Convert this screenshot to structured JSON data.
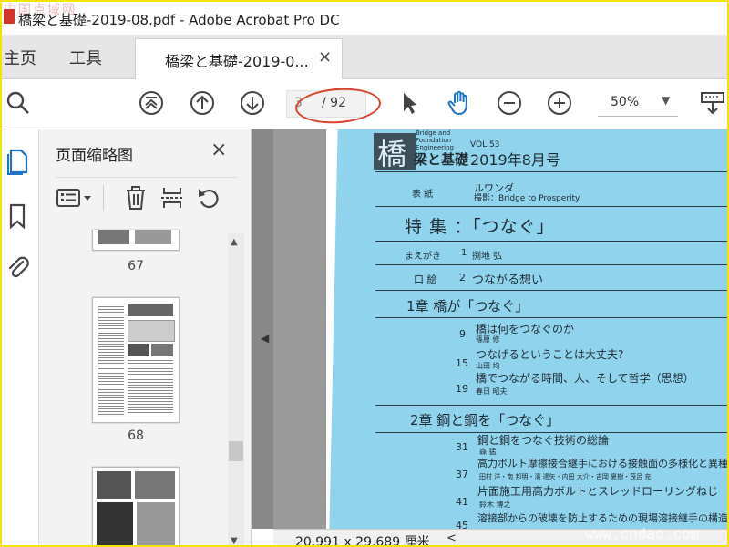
{
  "window": {
    "title": "橋梁と基礎-2019-08.pdf - Adobe Acrobat Pro DC",
    "watermark_top": "中国点域网"
  },
  "tabs": {
    "home": "主页",
    "tools": "工具",
    "document": "橋梁と基礎-2019-0...",
    "close": "×"
  },
  "toolbar": {
    "page_current": "3",
    "page_total": "/ 92",
    "zoom": "50%",
    "zoom_caret": "▼"
  },
  "thumbnails": {
    "title": "页面缩略图",
    "close": "×",
    "pages": [
      {
        "label": "67"
      },
      {
        "label": "68"
      },
      {
        "label": ""
      }
    ]
  },
  "document": {
    "logo_small": "Bridge and Foundation Engineering",
    "logo_char": "橋",
    "logo_rest": "梁と基礎",
    "vol": "VOL.53",
    "issue": "2019年8月号",
    "cover_label": "表 紙",
    "cover_title": "ルワンダ",
    "cover_credit": "撮影：Bridge to Prosperity",
    "feature": "特 集 ：「つなぐ」",
    "preface_label": "まえがき",
    "preface_num": "1",
    "preface_author": "捌地 弘",
    "kuchie_label": "口 絵",
    "kuchie_num": "2",
    "kuchie_title": "つながる想い",
    "ch1": "1章 橋が「つなぐ」",
    "ch1_items": [
      {
        "num": "9",
        "title": "橋は何をつなぐのか",
        "author": "篠原 修"
      },
      {
        "num": "15",
        "title": "つなげるということは大丈夫?",
        "author": "山田 均"
      },
      {
        "num": "19",
        "title": "橋でつながる時間、人、そして哲学（思想）",
        "author": "春日 昭夫"
      }
    ],
    "ch2": "2章 鋼と鋼を「つなぐ」",
    "ch2_items": [
      {
        "num": "31",
        "title": "鋼と鋼をつなぐ技術の総論",
        "author": "森 猛"
      },
      {
        "num": "37",
        "title": "高力ボルト摩擦接合継手における接触面の多様化と異種接",
        "author": "田村 洋・南 邦明・濱 達矢・内田 大介・吉岡 夏樹・茂呂 充"
      },
      {
        "num": "41",
        "title": "片面施工用高力ボルトとスレッドローリングねじ",
        "author": "鈴木 博之"
      },
      {
        "num": "45",
        "title": "溶接部からの破壊を防止するための現場溶接継手の構造",
        "author": ""
      }
    ]
  },
  "status": {
    "dimensions": "20.991 x 29.689 厘米",
    "arrow": "<"
  },
  "watermark_bottom": "www.cndao.com",
  "colors": {
    "accent": "#1a73c9",
    "annotation": "#d9432c",
    "scan_bg": "#8fd3ec",
    "frame": "#f2e600"
  }
}
